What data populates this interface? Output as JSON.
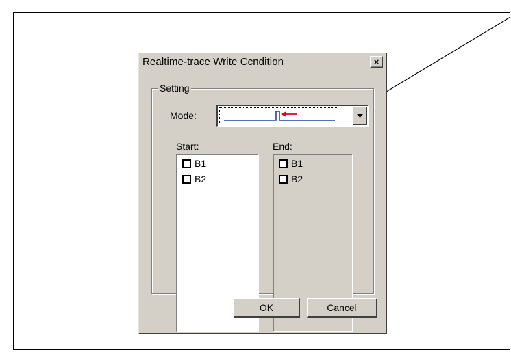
{
  "dialog": {
    "title": "Realtime-trace Write Ccndition",
    "close_glyph": "×"
  },
  "setting": {
    "group_label": "Setting",
    "mode_label": "Mode:",
    "mode_icon": "trigger-pulse-icon"
  },
  "start": {
    "label": "Start:",
    "items": [
      {
        "label": "B1",
        "checked": false
      },
      {
        "label": "B2",
        "checked": false
      }
    ]
  },
  "end": {
    "label": "End:",
    "items": [
      {
        "label": "B1",
        "checked": false
      },
      {
        "label": "B2",
        "checked": false
      }
    ]
  },
  "buttons": {
    "ok": "OK",
    "cancel": "Cancel"
  },
  "colors": {
    "face": "#d4d0c8",
    "signal_line": "#1f3fb8",
    "marker_arrow": "#e8001c"
  }
}
